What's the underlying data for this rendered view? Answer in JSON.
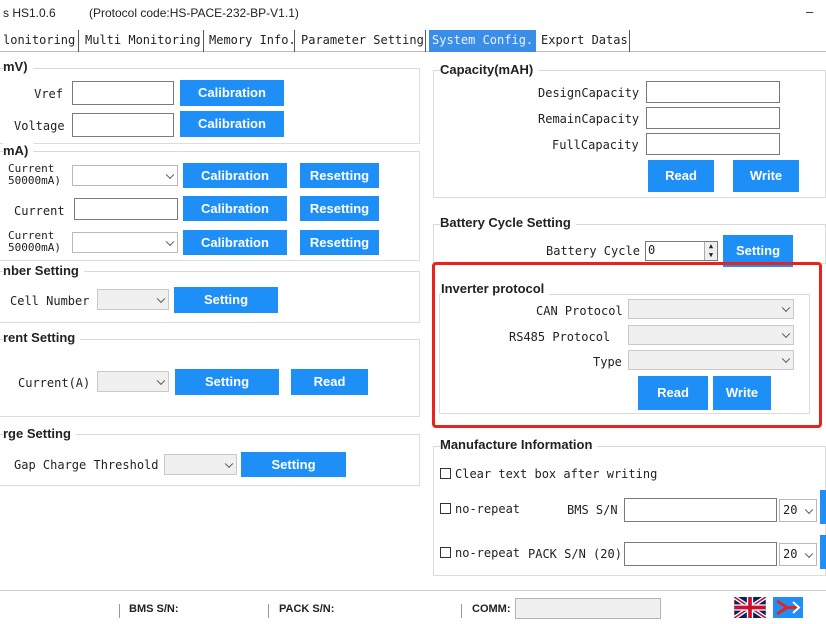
{
  "window": {
    "title": "s HS1.0.6",
    "protocol": "(Protocol code:HS-PACE-232-BP-V1.1)",
    "minimize": "–"
  },
  "tabs": [
    {
      "label": "lonitoring"
    },
    {
      "label": "Multi Monitoring"
    },
    {
      "label": "Memory Info."
    },
    {
      "label": "Parameter Setting"
    },
    {
      "label": "System Config."
    },
    {
      "label": "Export Datas"
    }
  ],
  "voltage_group": {
    "title": "mV)",
    "vref_label": "Vref",
    "voltage_label": "Voltage",
    "calibration": "Calibration"
  },
  "current_group": {
    "title": "mA)",
    "row1_label": "Current\n50000mA)",
    "row2_label": "Current",
    "row3_label": "Current\n50000mA)",
    "calibration": "Calibration",
    "resetting": "Resetting"
  },
  "cell_number_group": {
    "title": "nber Setting",
    "label": "Cell Number",
    "setting": "Setting"
  },
  "current_setting_group": {
    "title": "rent Setting",
    "label": "Current(A)",
    "setting": "Setting",
    "read": "Read"
  },
  "charge_setting_group": {
    "title": "rge Setting",
    "label": "Gap Charge Threshold",
    "setting": "Setting"
  },
  "capacity_group": {
    "title": "Capacity(mAH)",
    "design_label": "DesignCapacity",
    "remain_label": "RemainCapacity",
    "full_label": "FullCapacity",
    "read": "Read",
    "write": "Write"
  },
  "battery_cycle_group": {
    "title": "Battery Cycle Setting",
    "label": "Battery Cycle",
    "value": "0",
    "setting": "Setting"
  },
  "inverter_group": {
    "title": "Inverter protocol",
    "can_label": "CAN Protocol",
    "rs485_label": "RS485 Protocol",
    "type_label": "Type",
    "read": "Read",
    "write": "Write",
    "highlight_color": "#e8231b"
  },
  "manufacture_group": {
    "title": "Manufacture Information",
    "clear_label": "Clear text box after writing",
    "bms_norepeat": "no-repeat",
    "bms_label": "BMS S/N",
    "bms_len": "20",
    "pack_norepeat": "no-repeat",
    "pack_label": "PACK S/N (20)",
    "pack_len": "20"
  },
  "statusbar": {
    "bms": "BMS S/N:",
    "pack": "PACK S/N:",
    "comm": "COMM:"
  },
  "colors": {
    "accent": "#1e8ff6",
    "active_tab": "#3b8ee8"
  }
}
